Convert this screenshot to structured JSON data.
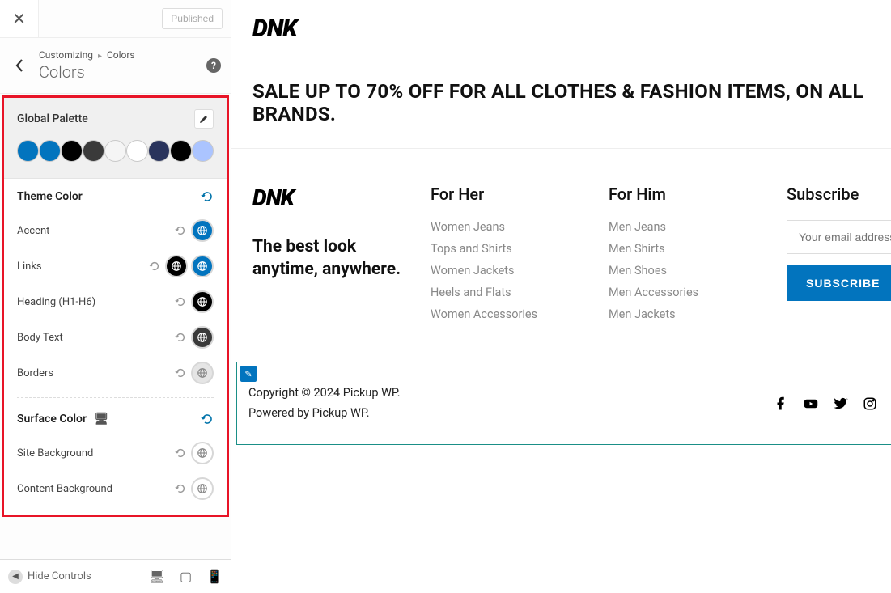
{
  "header": {
    "publish_status": "Published",
    "bc_customizing": "Customizing",
    "bc_section": "Colors",
    "title": "Colors"
  },
  "palette": {
    "title": "Global Palette",
    "colors": [
      "#0274be",
      "#0274be",
      "#000000",
      "#3a3a3a",
      "#f5f5f5",
      "#ffffff",
      "#29335c",
      "#000000",
      "#abc4ff"
    ]
  },
  "theme_color": {
    "title": "Theme Color",
    "rows": [
      {
        "label": "Accent",
        "dots": [
          "#0274be"
        ]
      },
      {
        "label": "Links",
        "dots": [
          "#000000",
          "#0274be"
        ]
      },
      {
        "label": "Heading (H1-H6)",
        "dots": [
          "#000000"
        ]
      },
      {
        "label": "Body Text",
        "dots": [
          "#3a3a3a"
        ]
      },
      {
        "label": "Borders",
        "dots": [
          "#e5e5e5"
        ]
      }
    ]
  },
  "surface_color": {
    "title": "Surface Color",
    "rows": [
      {
        "label": "Site Background",
        "dots": [
          "#ffffff"
        ]
      },
      {
        "label": "Content Background",
        "dots": [
          "#ffffff"
        ]
      }
    ]
  },
  "bottombar": {
    "hide": "Hide Controls"
  },
  "preview": {
    "logo": "DNK",
    "sale": "SALE UP TO 70% OFF FOR ALL CLOTHES & FASHION ITEMS, ON ALL BRANDS.",
    "tagline1": "The best look",
    "tagline2": "anytime, anywhere.",
    "for_her": {
      "title": "For Her",
      "items": [
        "Women Jeans",
        "Tops and Shirts",
        "Women Jackets",
        "Heels and Flats",
        "Women Accessories"
      ]
    },
    "for_him": {
      "title": "For Him",
      "items": [
        "Men Jeans",
        "Men Shirts",
        "Men Shoes",
        "Men Accessories",
        "Men Jackets"
      ]
    },
    "subscribe": {
      "title": "Subscribe",
      "placeholder": "Your email address...",
      "button": "SUBSCRIBE"
    },
    "copyright": "Copyright © 2024 Pickup WP.",
    "powered": "Powered by Pickup WP."
  }
}
